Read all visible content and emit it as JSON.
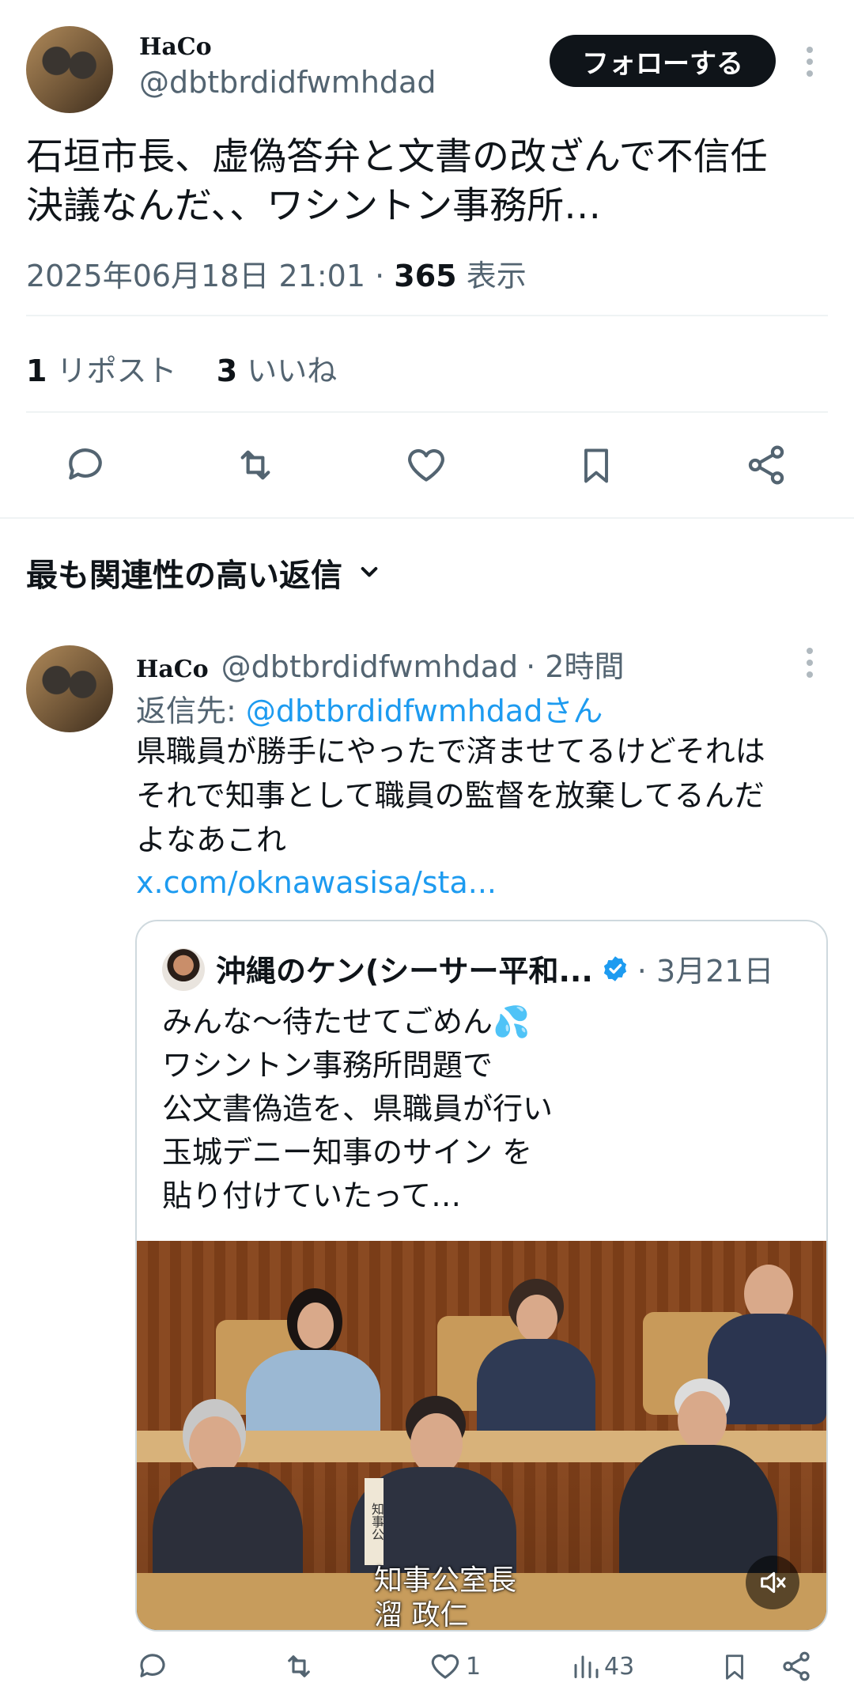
{
  "tweet": {
    "display_name": "HaCo",
    "handle": "@dbtbrdidfwmhdad",
    "follow_label": "フォローする",
    "text_line1": "石垣市長、虚偽答弁と文書の改ざんで不信任",
    "text_line2": "決議なんだ、、ワシントン事務所…",
    "timestamp": "2025年06月18日 21:01",
    "sep": "·",
    "views_count": "365",
    "views_label": "表示",
    "repost_count": "1",
    "repost_label": "リポスト",
    "like_count": "3",
    "like_label": "いいね"
  },
  "replies_header": {
    "label": "最も関連性の高い返信"
  },
  "reply": {
    "display_name": "HaCo",
    "handle": "@dbtbrdidfwmhdad",
    "time": "· 2時間",
    "reply_to_prefix": "返信先: ",
    "reply_to_handle": "@dbtbrdidfwmhdadさん",
    "text_line1": "県職員が勝手にやったで済ませてるけどそれは",
    "text_line2": "それで知事として職員の監督を放棄してるんだ",
    "text_line3": "よなあこれ",
    "link": "x.com/oknawasisa/sta...",
    "quote": {
      "name": "沖縄のケン(シーサー平和...",
      "date": "· 3月21日",
      "line1": "みんな〜待たせてごめん💦",
      "line2": "ワシントン事務所問題で",
      "line3": "公文書偽造を、県職員が行い",
      "line4": "玉城デニー知事のサイン を",
      "line5": "貼り付けていたって…",
      "video_caption_title": "知事公室長",
      "video_caption_name": "溜 政仁",
      "video_side_text": "知事公"
    },
    "likes": "1",
    "views": "43"
  },
  "icons": [
    "more-vert-icon",
    "reply-icon",
    "repost-icon",
    "like-icon",
    "bookmark-icon",
    "share-icon",
    "chevron-down-icon",
    "verified-icon",
    "mute-icon",
    "analytics-icon"
  ],
  "colors": {
    "accent": "#1d9bf0",
    "text": "#0f1419",
    "secondary": "#536471",
    "divider": "#eff3f4"
  }
}
